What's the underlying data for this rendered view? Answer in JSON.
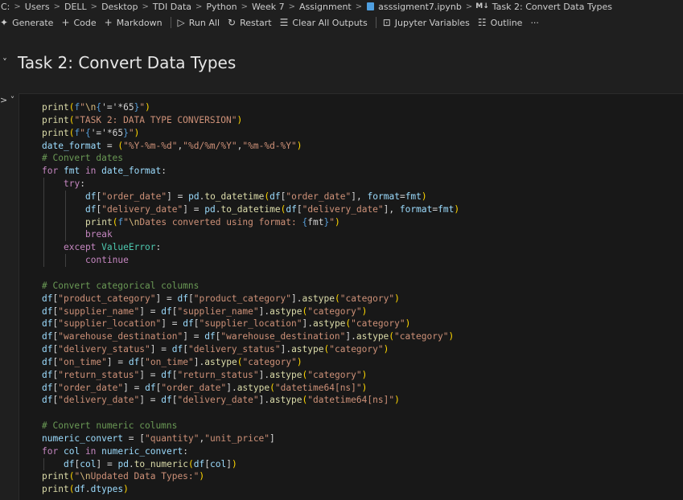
{
  "breadcrumb": {
    "items": [
      "C:",
      "Users",
      "DELL",
      "Desktop",
      "TDI Data",
      "Python",
      "Week 7",
      "Assignment",
      "asssigment7.ipynb",
      "Task 2: Convert Data Types"
    ],
    "separator": ">"
  },
  "toolbar": {
    "generate": "Generate",
    "code": "Code",
    "markdown": "Markdown",
    "run_all": "Run All",
    "restart": "Restart",
    "clear_outputs": "Clear All Outputs",
    "jupyter_variables": "Jupyter Variables",
    "outline": "Outline",
    "more": "···"
  },
  "markdown_cell": {
    "title": "Task 2: Convert Data Types"
  },
  "code_cell": {
    "gutter": "> ˅",
    "lines": [
      "print(f\"\\n{'='*65}\")",
      "print(\"TASK 2: DATA TYPE CONVERSION\")",
      "print(f\"{'='*65}\")",
      "date_format = (\"%Y-%m-%d\",\"%d/%m/%Y\",\"%m-%d-%Y\")",
      "# Convert dates",
      "for fmt in date_format:",
      "    try:",
      "        df[\"order_date\"] = pd.to_datetime(df[\"order_date\"], format=fmt)",
      "        df[\"delivery_date\"] = pd.to_datetime(df[\"delivery_date\"], format=fmt)",
      "        print(f\"\\nDates converted using format: {fmt}\")",
      "        break",
      "    except ValueError:",
      "        continue",
      "",
      "# Convert categorical columns",
      "df[\"product_category\"] = df[\"product_category\"].astype(\"category\")",
      "df[\"supplier_name\"] = df[\"supplier_name\"].astype(\"category\")",
      "df[\"supplier_location\"] = df[\"supplier_location\"].astype(\"category\")",
      "df[\"warehouse_destination\"] = df[\"warehouse_destination\"].astype(\"category\")",
      "df[\"delivery_status\"] = df[\"delivery_status\"].astype(\"category\")",
      "df[\"on_time\"] = df[\"on_time\"].astype(\"category\")",
      "df[\"return_status\"] = df[\"return_status\"].astype(\"category\")",
      "df[\"order_date\"] = df[\"order_date\"].astype(\"datetime64[ns]\")",
      "df[\"delivery_date\"] = df[\"delivery_date\"].astype(\"datetime64[ns]\")",
      "",
      "# Convert numeric columns",
      "numeric_convert = [\"quantity\",\"unit_price\"]",
      "for col in numeric_convert:",
      "    df[col] = pd.to_numeric(df[col])",
      "print(\"\\nUpdated Data Types:\")",
      "print(df.dtypes)"
    ]
  },
  "colors": {
    "background": "#1f1f1f",
    "cell_background": "#181818",
    "keyword": "#c586c0",
    "function": "#dcdcaa",
    "string": "#ce9178",
    "variable": "#9cdcfe",
    "comment": "#6a9955",
    "type": "#4ec9b0"
  }
}
